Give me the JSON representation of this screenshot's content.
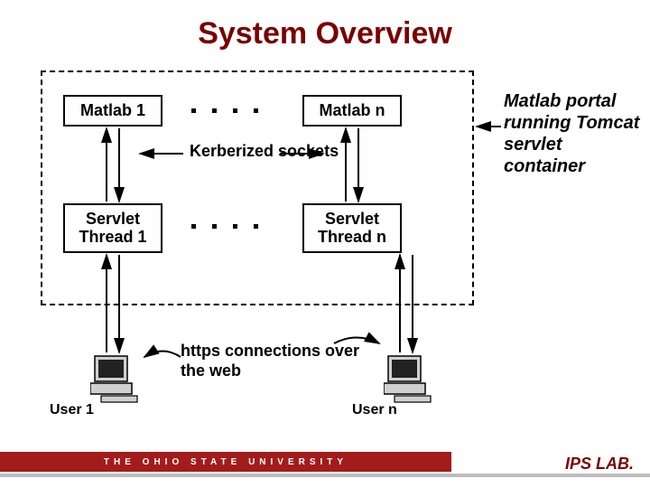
{
  "title": "System Overview",
  "boxes": {
    "matlab1": "Matlab 1",
    "matlabn": "Matlab n",
    "servlet1": "Servlet Thread 1",
    "servletn": "Servlet Thread n"
  },
  "labels": {
    "kerberized": "Kerberized sockets",
    "https": "https connections over the web"
  },
  "annotation": "Matlab portal running Tomcat servlet container",
  "users": {
    "user1": "User 1",
    "usern": "User n"
  },
  "footer": {
    "university": "THE OHIO STATE UNIVERSITY",
    "lab": "IPS LAB."
  }
}
